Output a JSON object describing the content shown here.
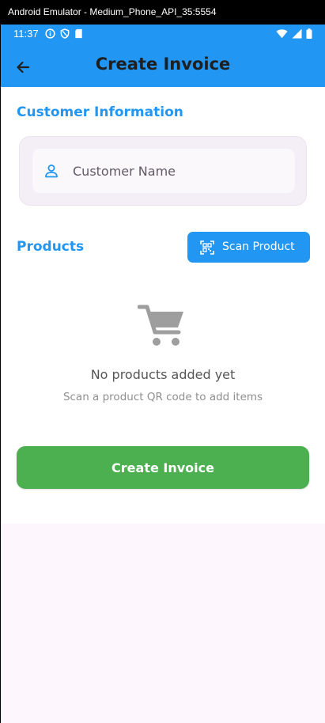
{
  "window": {
    "title": "Android Emulator - Medium_Phone_API_35:5554"
  },
  "status_bar": {
    "time": "11:37",
    "left_icons": [
      "info-icon",
      "shield-icon",
      "sim-card-icon"
    ],
    "right_icons": [
      "wifi-icon",
      "cell-signal-icon",
      "battery-icon"
    ]
  },
  "app_bar": {
    "title": "Create Invoice",
    "back_icon": "arrow-back-icon",
    "color": "#2196f3"
  },
  "customer_section": {
    "title": "Customer Information",
    "field": {
      "placeholder": "Customer Name",
      "value": "",
      "icon": "person-icon"
    }
  },
  "products_section": {
    "title": "Products",
    "scan_button": {
      "label": "Scan Product",
      "icon": "qr-scan-icon"
    },
    "empty_state": {
      "icon": "shopping-cart-icon",
      "title": "No products added yet",
      "subtitle": "Scan a product QR code to add items"
    }
  },
  "actions": {
    "create_button": {
      "label": "Create Invoice",
      "color": "#4caf50"
    }
  }
}
